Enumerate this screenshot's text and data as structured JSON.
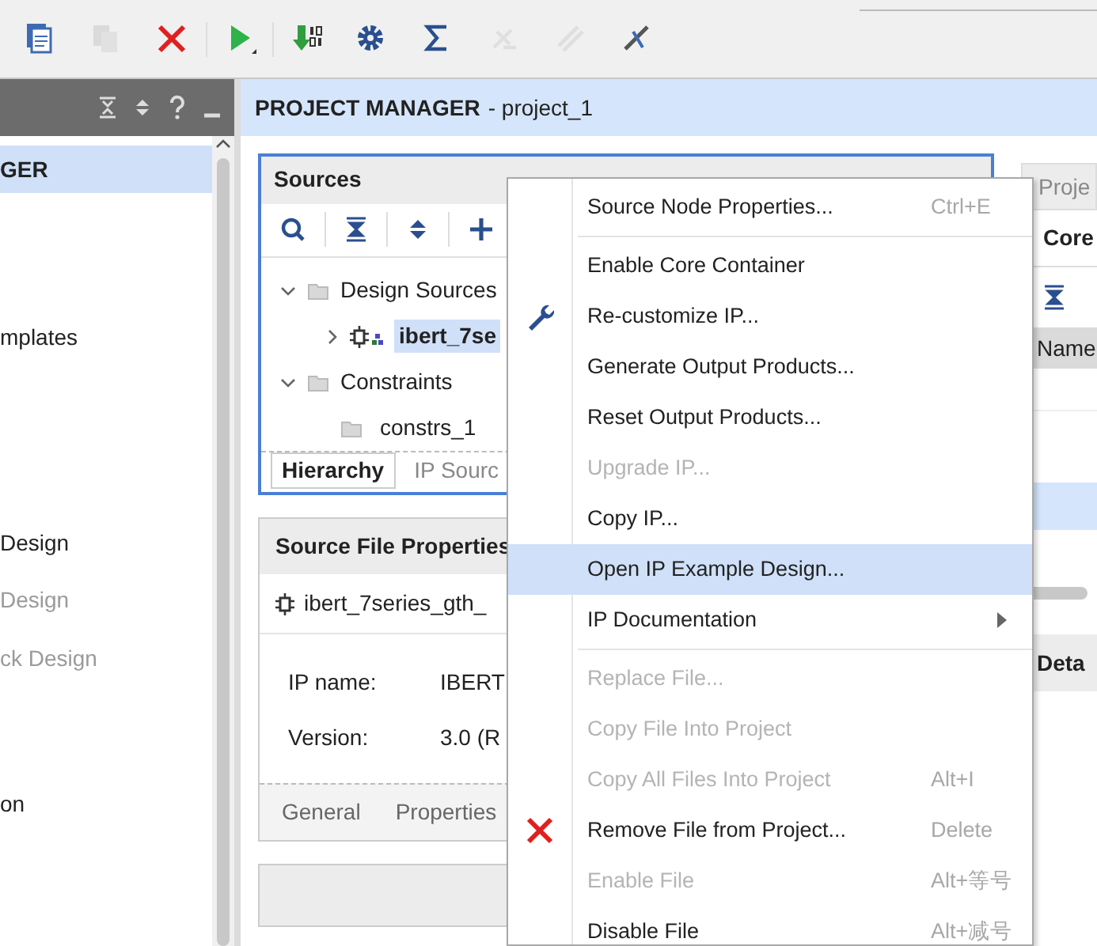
{
  "toolbar": [
    {
      "disabled": false
    },
    {
      "disabled": true
    },
    {
      "disabled": false
    },
    {
      "disabled": false
    },
    {
      "disabled": false
    },
    {
      "disabled": false
    },
    {
      "disabled": false
    },
    {
      "disabled": true
    },
    {
      "disabled": true
    },
    {
      "disabled": false
    }
  ],
  "left_panel": {
    "items": [
      {
        "label": "GER",
        "selected": true,
        "disabled": false
      },
      {
        "label": "mplates",
        "selected": false,
        "disabled": false
      },
      {
        "label": "Design",
        "selected": false,
        "disabled": false
      },
      {
        "label": "Design",
        "selected": false,
        "disabled": true
      },
      {
        "label": "ck Design",
        "selected": false,
        "disabled": true
      },
      {
        "label": "on",
        "selected": false,
        "disabled": false
      }
    ]
  },
  "main_header": {
    "title": "PROJECT MANAGER",
    "subtitle": "- project_1"
  },
  "sources": {
    "title": "Sources",
    "tree": [
      {
        "label": "Design Sources",
        "expanded": true,
        "children": [
          {
            "label": "ibert_7se",
            "selected": true,
            "expanded": false
          }
        ]
      },
      {
        "label": "Constraints",
        "expanded": true,
        "children": [
          {
            "label": "constrs_1",
            "selected": false
          }
        ]
      }
    ],
    "tabs": [
      {
        "label": "Hierarchy",
        "selected": true
      },
      {
        "label": "IP Sourc",
        "selected": false
      }
    ]
  },
  "source_file_properties": {
    "title": "Source File Properties",
    "file": "ibert_7series_gth_",
    "fields": [
      {
        "label": "IP name:",
        "value": "IBERT"
      },
      {
        "label": "Version:",
        "value": "3.0 (R"
      }
    ],
    "tabs": [
      {
        "label": "General",
        "selected": false
      },
      {
        "label": "Properties",
        "selected": false
      }
    ]
  },
  "right_panel": {
    "title": "Proje",
    "subtitle": "Core",
    "column": "Name",
    "detail_title": "Deta"
  },
  "context_menu": [
    {
      "label": "Source Node Properties...",
      "shortcut": "Ctrl+E",
      "disabled": false,
      "selected": false,
      "separator_after": true
    },
    {
      "label": "Enable Core Container",
      "disabled": false,
      "selected": false,
      "separator_after": false
    },
    {
      "label": "Re-customize IP...",
      "disabled": false,
      "selected": false,
      "separator_after": false
    },
    {
      "label": "Generate Output Products...",
      "disabled": false,
      "selected": false,
      "separator_after": false
    },
    {
      "label": "Reset Output Products...",
      "disabled": false,
      "selected": false,
      "separator_after": false
    },
    {
      "label": "Upgrade IP...",
      "disabled": true,
      "selected": false,
      "separator_after": false
    },
    {
      "label": "Copy IP...",
      "disabled": false,
      "selected": false,
      "separator_after": false
    },
    {
      "label": "Open IP Example Design...",
      "disabled": false,
      "selected": true,
      "separator_after": false
    },
    {
      "label": "IP Documentation",
      "disabled": false,
      "selected": false,
      "submenu": true,
      "separator_after": true
    },
    {
      "label": "Replace File...",
      "disabled": true,
      "selected": false,
      "separator_after": false
    },
    {
      "label": "Copy File Into Project",
      "disabled": true,
      "selected": false,
      "separator_after": false
    },
    {
      "label": "Copy All Files Into Project",
      "shortcut": "Alt+I",
      "disabled": true,
      "selected": false,
      "separator_after": false
    },
    {
      "label": "Remove File from Project...",
      "shortcut": "Delete",
      "disabled": false,
      "selected": false,
      "separator_after": false
    },
    {
      "label": "Enable File",
      "shortcut": "Alt+等号",
      "disabled": true,
      "selected": false,
      "separator_after": false
    },
    {
      "label": "Disable File",
      "shortcut": "Alt+减号",
      "disabled": false,
      "selected": false,
      "separator_after": false
    }
  ]
}
